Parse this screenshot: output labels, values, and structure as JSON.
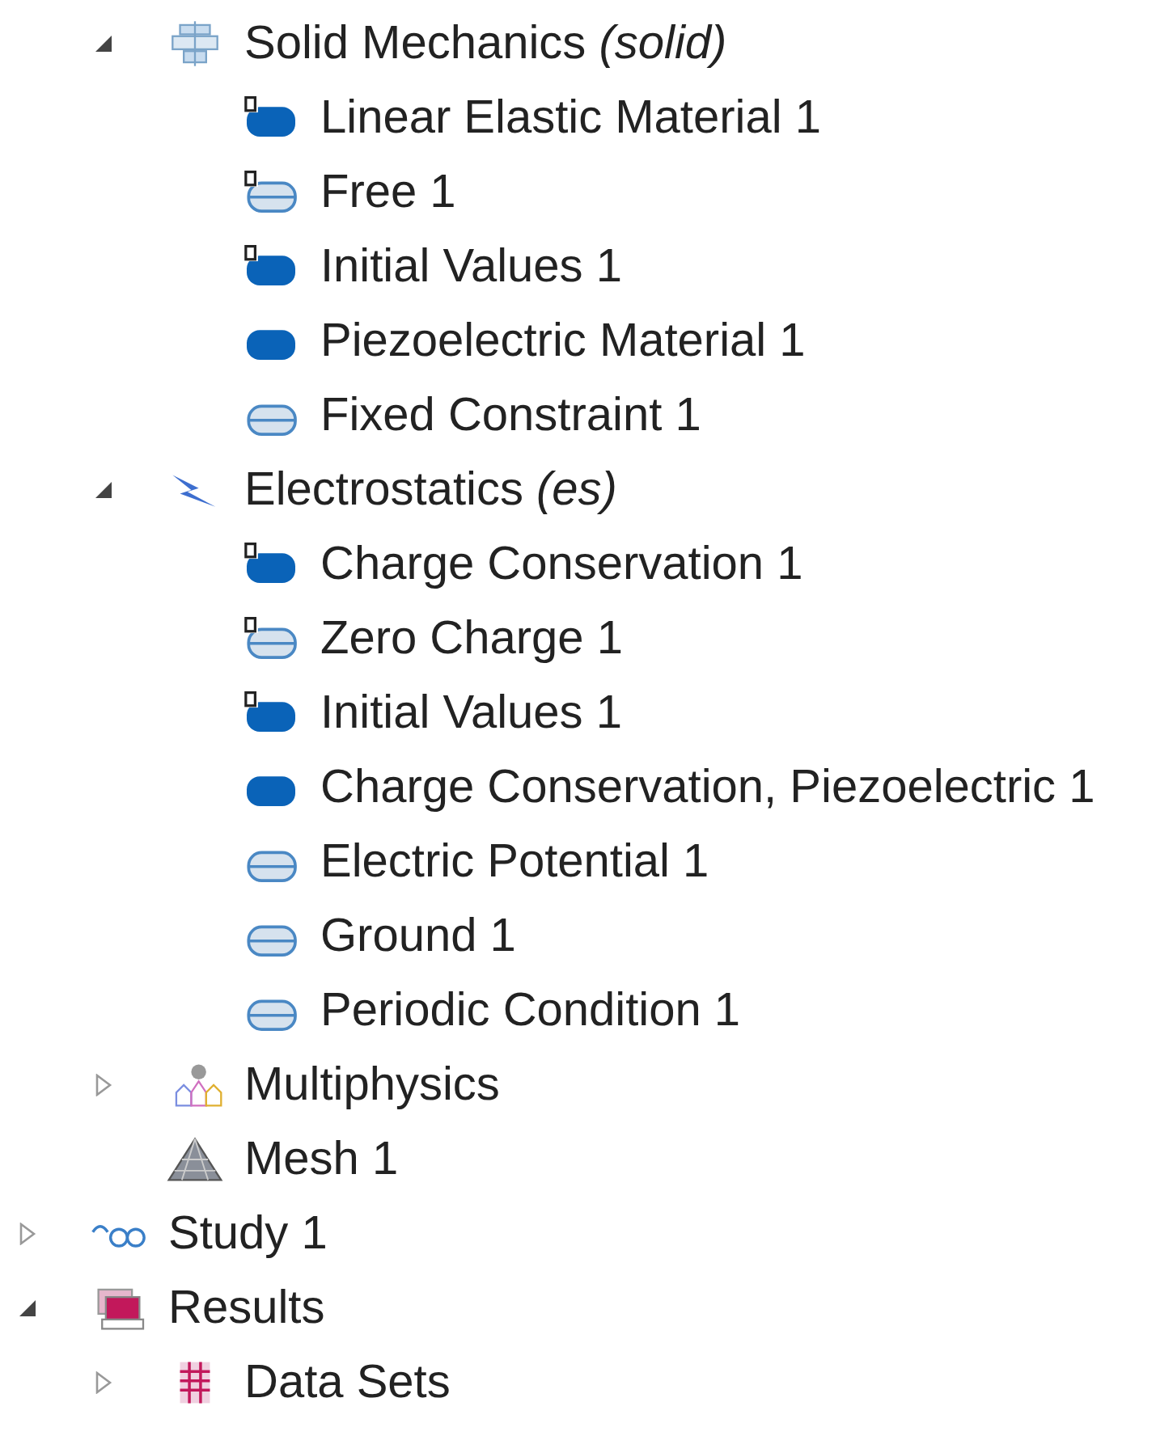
{
  "tree": [
    {
      "children": [
        {
          "label": "Solid Mechanics *(solid)*",
          "kind": "solid",
          "expanded": true,
          "children": [
            {
              "label": "Linear Elastic Material 1",
              "kind": "domaindefault"
            },
            {
              "label": "Free 1",
              "kind": "boundarydefault"
            },
            {
              "label": "Initial Values 1",
              "kind": "domaindefault"
            },
            {
              "label": "Piezoelectric Material 1",
              "kind": "domain"
            },
            {
              "label": "Fixed Constraint 1",
              "kind": "boundary"
            }
          ]
        },
        {
          "label": "Electrostatics *(es)*",
          "kind": "electrostatics",
          "expanded": true,
          "children": [
            {
              "label": "Charge Conservation 1",
              "kind": "domaindefault"
            },
            {
              "label": "Zero Charge 1",
              "kind": "boundarydefault"
            },
            {
              "label": "Initial Values 1",
              "kind": "domaindefault"
            },
            {
              "label": "Charge Conservation, Piezoelectric 1",
              "kind": "domain"
            },
            {
              "label": "Electric Potential 1",
              "kind": "boundary"
            },
            {
              "label": "Ground 1",
              "kind": "boundary"
            },
            {
              "label": "Periodic Condition 1",
              "kind": "boundary"
            }
          ]
        },
        {
          "label": "Multiphysics",
          "kind": "multiphysics",
          "expanded": false
        },
        {
          "label": "Mesh 1",
          "kind": "mesh"
        }
      ]
    },
    {
      "label": "Study 1",
      "kind": "study",
      "expanded": false
    },
    {
      "label": "Results",
      "kind": "results",
      "expanded": true,
      "children": [
        {
          "label": "Data Sets",
          "kind": "datasets",
          "expanded": false
        }
      ]
    }
  ]
}
